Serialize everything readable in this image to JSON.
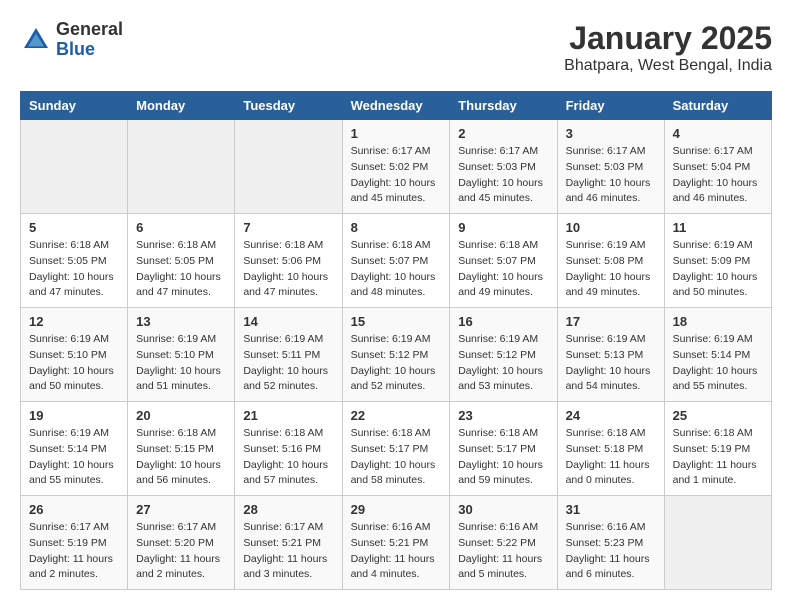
{
  "header": {
    "logo_general": "General",
    "logo_blue": "Blue",
    "month_title": "January 2025",
    "location": "Bhatpara, West Bengal, India"
  },
  "days_of_week": [
    "Sunday",
    "Monday",
    "Tuesday",
    "Wednesday",
    "Thursday",
    "Friday",
    "Saturday"
  ],
  "weeks": [
    [
      {
        "day": "",
        "info": ""
      },
      {
        "day": "",
        "info": ""
      },
      {
        "day": "",
        "info": ""
      },
      {
        "day": "1",
        "info": "Sunrise: 6:17 AM\nSunset: 5:02 PM\nDaylight: 10 hours\nand 45 minutes."
      },
      {
        "day": "2",
        "info": "Sunrise: 6:17 AM\nSunset: 5:03 PM\nDaylight: 10 hours\nand 45 minutes."
      },
      {
        "day": "3",
        "info": "Sunrise: 6:17 AM\nSunset: 5:03 PM\nDaylight: 10 hours\nand 46 minutes."
      },
      {
        "day": "4",
        "info": "Sunrise: 6:17 AM\nSunset: 5:04 PM\nDaylight: 10 hours\nand 46 minutes."
      }
    ],
    [
      {
        "day": "5",
        "info": "Sunrise: 6:18 AM\nSunset: 5:05 PM\nDaylight: 10 hours\nand 47 minutes."
      },
      {
        "day": "6",
        "info": "Sunrise: 6:18 AM\nSunset: 5:05 PM\nDaylight: 10 hours\nand 47 minutes."
      },
      {
        "day": "7",
        "info": "Sunrise: 6:18 AM\nSunset: 5:06 PM\nDaylight: 10 hours\nand 47 minutes."
      },
      {
        "day": "8",
        "info": "Sunrise: 6:18 AM\nSunset: 5:07 PM\nDaylight: 10 hours\nand 48 minutes."
      },
      {
        "day": "9",
        "info": "Sunrise: 6:18 AM\nSunset: 5:07 PM\nDaylight: 10 hours\nand 49 minutes."
      },
      {
        "day": "10",
        "info": "Sunrise: 6:19 AM\nSunset: 5:08 PM\nDaylight: 10 hours\nand 49 minutes."
      },
      {
        "day": "11",
        "info": "Sunrise: 6:19 AM\nSunset: 5:09 PM\nDaylight: 10 hours\nand 50 minutes."
      }
    ],
    [
      {
        "day": "12",
        "info": "Sunrise: 6:19 AM\nSunset: 5:10 PM\nDaylight: 10 hours\nand 50 minutes."
      },
      {
        "day": "13",
        "info": "Sunrise: 6:19 AM\nSunset: 5:10 PM\nDaylight: 10 hours\nand 51 minutes."
      },
      {
        "day": "14",
        "info": "Sunrise: 6:19 AM\nSunset: 5:11 PM\nDaylight: 10 hours\nand 52 minutes."
      },
      {
        "day": "15",
        "info": "Sunrise: 6:19 AM\nSunset: 5:12 PM\nDaylight: 10 hours\nand 52 minutes."
      },
      {
        "day": "16",
        "info": "Sunrise: 6:19 AM\nSunset: 5:12 PM\nDaylight: 10 hours\nand 53 minutes."
      },
      {
        "day": "17",
        "info": "Sunrise: 6:19 AM\nSunset: 5:13 PM\nDaylight: 10 hours\nand 54 minutes."
      },
      {
        "day": "18",
        "info": "Sunrise: 6:19 AM\nSunset: 5:14 PM\nDaylight: 10 hours\nand 55 minutes."
      }
    ],
    [
      {
        "day": "19",
        "info": "Sunrise: 6:19 AM\nSunset: 5:14 PM\nDaylight: 10 hours\nand 55 minutes."
      },
      {
        "day": "20",
        "info": "Sunrise: 6:18 AM\nSunset: 5:15 PM\nDaylight: 10 hours\nand 56 minutes."
      },
      {
        "day": "21",
        "info": "Sunrise: 6:18 AM\nSunset: 5:16 PM\nDaylight: 10 hours\nand 57 minutes."
      },
      {
        "day": "22",
        "info": "Sunrise: 6:18 AM\nSunset: 5:17 PM\nDaylight: 10 hours\nand 58 minutes."
      },
      {
        "day": "23",
        "info": "Sunrise: 6:18 AM\nSunset: 5:17 PM\nDaylight: 10 hours\nand 59 minutes."
      },
      {
        "day": "24",
        "info": "Sunrise: 6:18 AM\nSunset: 5:18 PM\nDaylight: 11 hours\nand 0 minutes."
      },
      {
        "day": "25",
        "info": "Sunrise: 6:18 AM\nSunset: 5:19 PM\nDaylight: 11 hours\nand 1 minute."
      }
    ],
    [
      {
        "day": "26",
        "info": "Sunrise: 6:17 AM\nSunset: 5:19 PM\nDaylight: 11 hours\nand 2 minutes."
      },
      {
        "day": "27",
        "info": "Sunrise: 6:17 AM\nSunset: 5:20 PM\nDaylight: 11 hours\nand 2 minutes."
      },
      {
        "day": "28",
        "info": "Sunrise: 6:17 AM\nSunset: 5:21 PM\nDaylight: 11 hours\nand 3 minutes."
      },
      {
        "day": "29",
        "info": "Sunrise: 6:16 AM\nSunset: 5:21 PM\nDaylight: 11 hours\nand 4 minutes."
      },
      {
        "day": "30",
        "info": "Sunrise: 6:16 AM\nSunset: 5:22 PM\nDaylight: 11 hours\nand 5 minutes."
      },
      {
        "day": "31",
        "info": "Sunrise: 6:16 AM\nSunset: 5:23 PM\nDaylight: 11 hours\nand 6 minutes."
      },
      {
        "day": "",
        "info": ""
      }
    ]
  ]
}
